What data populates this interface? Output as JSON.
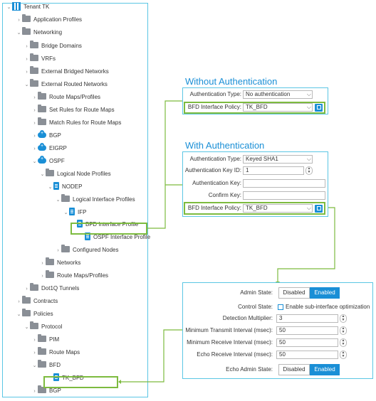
{
  "tree": {
    "items": [
      {
        "label": "Tenant TK",
        "icon": "tenant-icon",
        "chev": "v"
      },
      {
        "label": "Application Profiles",
        "icon": "folder-icon",
        "chev": ">"
      },
      {
        "label": "Networking",
        "icon": "folder-icon",
        "chev": "v"
      },
      {
        "label": "Bridge Domains",
        "icon": "folder-icon",
        "chev": ">"
      },
      {
        "label": "VRFs",
        "icon": "folder-icon",
        "chev": ">"
      },
      {
        "label": "External Bridged Networks",
        "icon": "folder-icon",
        "chev": ">"
      },
      {
        "label": "External Routed Networks",
        "icon": "folder-icon",
        "chev": "v"
      },
      {
        "label": "Route Maps/Profiles",
        "icon": "folder-icon",
        "chev": ">"
      },
      {
        "label": "Set Rules for Route Maps",
        "icon": "folder-icon",
        "chev": ">"
      },
      {
        "label": "Match Rules for Route Maps",
        "icon": "folder-icon",
        "chev": ">"
      },
      {
        "label": "BGP",
        "icon": "cloud-icon",
        "chev": ">"
      },
      {
        "label": "EIGRP",
        "icon": "cloud-icon",
        "chev": ">"
      },
      {
        "label": "OSPF",
        "icon": "cloud-icon",
        "chev": "v"
      },
      {
        "label": "Logical Node Profiles",
        "icon": "folder-icon",
        "chev": "v"
      },
      {
        "label": "NODEP",
        "icon": "doc-icon",
        "chev": "v"
      },
      {
        "label": "Logical Interface Profiles",
        "icon": "folder-icon",
        "chev": "v"
      },
      {
        "label": "IFP",
        "icon": "doc-icon",
        "chev": "v"
      },
      {
        "label": "BFD Interface Profile",
        "icon": "doc-icon",
        "chev": ""
      },
      {
        "label": "OSPF Interface Profile",
        "icon": "doc-icon",
        "chev": ""
      },
      {
        "label": "Configured Nodes",
        "icon": "folder-icon",
        "chev": ">"
      },
      {
        "label": "Networks",
        "icon": "folder-icon",
        "chev": ">"
      },
      {
        "label": "Route Maps/Profiles",
        "icon": "folder-icon",
        "chev": ">"
      },
      {
        "label": "Dot1Q Tunnels",
        "icon": "folder-icon",
        "chev": ">"
      },
      {
        "label": "Contracts",
        "icon": "folder-icon",
        "chev": ">"
      },
      {
        "label": "Policies",
        "icon": "folder-icon",
        "chev": "v"
      },
      {
        "label": "Protocol",
        "icon": "folder-icon",
        "chev": "v"
      },
      {
        "label": "PIM",
        "icon": "folder-icon",
        "chev": ">"
      },
      {
        "label": "Route Maps",
        "icon": "folder-icon",
        "chev": ">"
      },
      {
        "label": "BFD",
        "icon": "folder-icon",
        "chev": "v"
      },
      {
        "label": "TK_BFD",
        "icon": "doc-icon",
        "chev": ""
      },
      {
        "label": "BGP",
        "icon": "folder-icon",
        "chev": ">"
      }
    ]
  },
  "without_auth": {
    "heading": "Without Authentication",
    "auth_type_label": "Authentication Type:",
    "auth_type_value": "No authentication",
    "bfd_policy_label": "BFD Interface Policy:",
    "bfd_policy_value": "TK_BFD"
  },
  "with_auth": {
    "heading": "With Authentication",
    "auth_type_label": "Authentication Type:",
    "auth_type_value": "Keyed SHA1",
    "key_id_label": "Authentication Key ID:",
    "key_id_value": "1",
    "key_label": "Authentication Key:",
    "key_value": "",
    "confirm_label": "Confirm Key:",
    "confirm_value": "",
    "bfd_policy_label": "BFD Interface Policy:",
    "bfd_policy_value": "TK_BFD"
  },
  "bfd_policy": {
    "admin_state_label": "Admin State:",
    "admin_disabled": "Disabled",
    "admin_enabled": "Enabled",
    "control_state_label": "Control State:",
    "control_state_option": "Enable sub-interface optimization",
    "detect_mult_label": "Detection Multiplier:",
    "detect_mult_value": "3",
    "min_tx_label": "Minimum Transmit Interval (msec):",
    "min_tx_value": "50",
    "min_rx_label": "Minimum Receive Interval (msec):",
    "min_rx_value": "50",
    "echo_rx_label": "Echo Receive Interval (msec):",
    "echo_rx_value": "50",
    "echo_admin_label": "Echo Admin State:",
    "echo_disabled": "Disabled",
    "echo_enabled": "Enabled"
  },
  "colors": {
    "accent": "#1a8fd6",
    "panel_border": "#5bc6e4",
    "highlight": "#7dbb3f"
  }
}
